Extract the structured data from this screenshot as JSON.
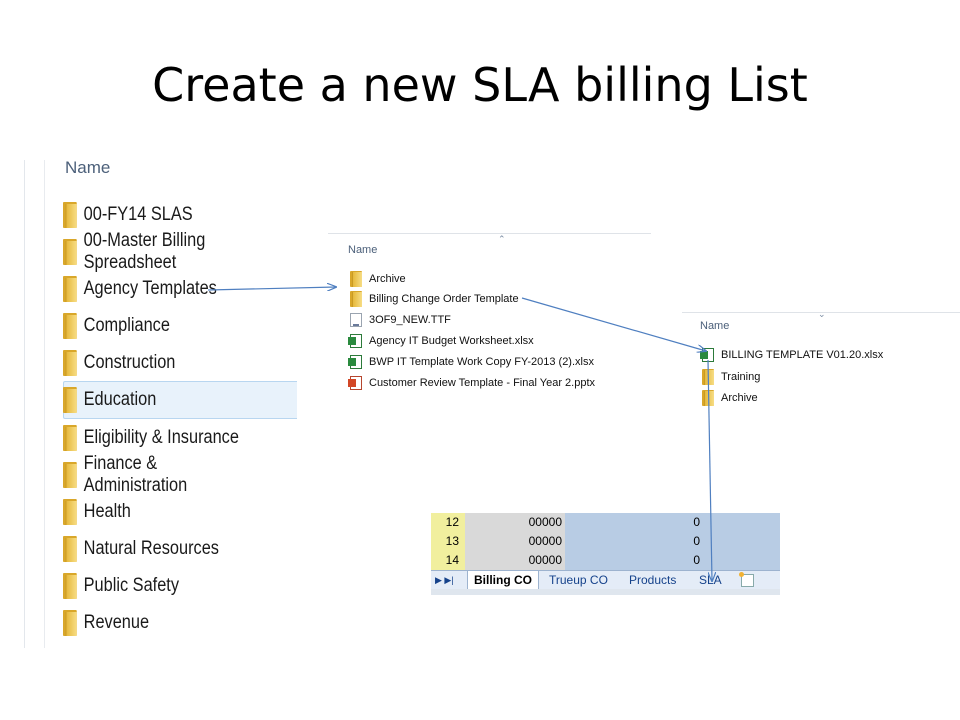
{
  "slide_title": "Create a new SLA billing List",
  "left_panel": {
    "header": "Name",
    "items": [
      {
        "label": "00-FY14 SLAS"
      },
      {
        "label": "00-Master Billing Spreadsheet"
      },
      {
        "label": "Agency Templates"
      },
      {
        "label": "Compliance"
      },
      {
        "label": "Construction"
      },
      {
        "label": "Education",
        "selected": true
      },
      {
        "label": "Eligibility & Insurance"
      },
      {
        "label": "Finance & Administration"
      },
      {
        "label": "Health"
      },
      {
        "label": "Natural Resources"
      },
      {
        "label": "Public Safety"
      },
      {
        "label": "Revenue"
      }
    ]
  },
  "mid_panel": {
    "header": "Name",
    "items": [
      {
        "label": "Archive",
        "icon": "folder-icon"
      },
      {
        "label": "Billing Change Order Template",
        "icon": "folder-icon"
      },
      {
        "label": "3OF9_NEW.TTF",
        "icon": "font-file-icon"
      },
      {
        "label": "Agency IT Budget Worksheet.xlsx",
        "icon": "excel-file-icon"
      },
      {
        "label": "BWP IT Template Work Copy FY-2013 (2).xlsx",
        "icon": "excel-file-icon"
      },
      {
        "label": "Customer Review Template - Final Year 2.pptx",
        "icon": "powerpoint-file-icon"
      }
    ]
  },
  "right_panel": {
    "header": "Name",
    "items": [
      {
        "label": "BILLING TEMPLATE V01.20.xlsx",
        "icon": "excel-file-icon"
      },
      {
        "label": "Training",
        "icon": "folder-icon"
      },
      {
        "label": "Archive",
        "icon": "folder-icon"
      }
    ]
  },
  "spreadsheet": {
    "rows": [
      {
        "row": "12",
        "a": "00000",
        "b": "0"
      },
      {
        "row": "13",
        "a": "00000",
        "b": "0"
      },
      {
        "row": "14",
        "a": "00000",
        "b": "0"
      }
    ],
    "tabs": [
      "Billing CO",
      "Trueup CO",
      "Products",
      "SLA"
    ],
    "active_tab": "Billing CO"
  },
  "colors": {
    "arrow": "#4f7fc0",
    "selection": "#e8f2fb",
    "folder": "#e6b93c"
  }
}
